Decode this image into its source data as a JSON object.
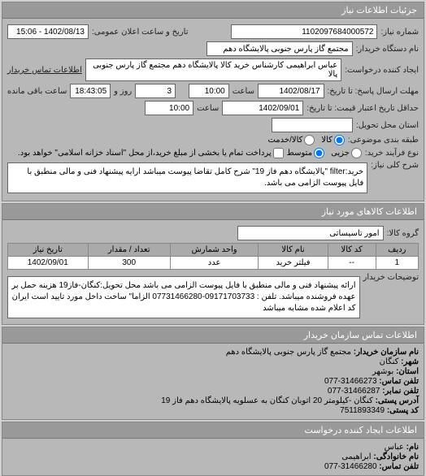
{
  "panel1": {
    "title": "جزئیات اطلاعات نیاز",
    "niaz_number_label": "شماره نیاز:",
    "niaz_number": "1102097684000572",
    "public_date_label": "تاریخ و ساعت اعلان عمومی:",
    "public_date": "1402/08/13 - 15:06",
    "buyer_org_label": "نام دستگاه خریدار:",
    "buyer_org": "مجتمع گاز پارس جنوبی پالایشگاه دهم",
    "requester_label": "ایجاد کننده درخواست:",
    "requester": "عباس ابراهیمی کارشناس خرید کالا پالایشگاه دهم مجتمع گاز پارس جنوبی پالا",
    "buyer_contact_label": "اطلاعات تماس خریدار",
    "deadline_label": "مهلت ارسال پاسخ: تا تاریخ:",
    "deadline_date": "1402/08/17",
    "time_label": "ساعت",
    "deadline_time": "10:00",
    "days_label": "روز و",
    "days_value": "3",
    "hours_left_label": "ساعت باقی مانده",
    "hours_left": "18:43:05",
    "validity_label": "حداقل تاریخ اعتبار قیمت: تا تاریخ:",
    "validity_date": "1402/09/01",
    "validity_time": "10:00",
    "delivery_location_label": "استان محل تحویل:",
    "delivery_location": "",
    "budget_label": "طبقه بندی موضوعی:",
    "budget_radio_kala": "کالا",
    "budget_radio_jozei": "کالا/خدمت",
    "pay_type_label": "نوع فرآیند خرید:",
    "pay_radio1": "جزیی",
    "pay_radio2": "متوسط",
    "pay_note": "پرداخت تمام یا بخشی از مبلغ خرید،از محل \"اسناد خزانه اسلامی\" خواهد بود.",
    "general_desc_label": "شرح کلی نیاز:",
    "general_desc": "خرید:filter \"پالایشگاه دهم فاز 19\" شرح کامل تقاضا پیوست میباشد ارایه پیشنهاد فنی و مالی منطبق با فایل پیوست الزامی می باشد."
  },
  "panel2": {
    "title": "اطلاعات کالاهای مورد نیاز",
    "group_label": "گروه کالا:",
    "group_value": "امور تاسیساتی",
    "table": {
      "headers": [
        "ردیف",
        "کد کالا",
        "نام کالا",
        "واحد شمارش",
        "تعداد / مقدار",
        "تاریخ نیاز"
      ],
      "rows": [
        [
          "1",
          "--",
          "فیلتر خرید",
          "عدد",
          "300",
          "1402/09/01"
        ]
      ]
    },
    "notes_label": "توضیحات خریدار",
    "notes": "ارائه پیشنهاد فنی و مالی منطبق با فایل پیوست الزامی می باشد محل تحویل:کنگان-فاز19 هزینه حمل بر عهده فروشنده میباشد. تلفن : 09171703733-07731466280 الزاما\" ساخت داخل مورد تایید است ایران کد اعلام شده مشابه میباشد"
  },
  "panel3": {
    "title": "اطلاعات تماس سازمان خریدار",
    "org_label": "نام سازمان خریدار:",
    "org": "مجتمع گاز پارس جنوبی پالایشگاه دهم",
    "city_label": "شهر:",
    "city": "کنگان",
    "province_label": "استان:",
    "province": "بوشهر",
    "phone_label": "تلفن تماس:",
    "phone": "31466273-077",
    "fax_label": "تلفن نمابر:",
    "fax": "31466287-077",
    "address_label": "آدرس پستی:",
    "address": "کنگان -کیلومتر 20 اتوبان کنگان به عسلویه پالایشگاه دهم فاز 19",
    "postal_label": "کد پستی:",
    "postal": "7511893349"
  },
  "panel4": {
    "title": "اطلاعات ایجاد کننده درخواست",
    "name_label": "نام:",
    "name": "عباس",
    "family_label": "نام خانوادگی:",
    "family": "ابراهیمی",
    "phone2_label": "تلفن تماس:",
    "phone2": "31466280-077"
  }
}
